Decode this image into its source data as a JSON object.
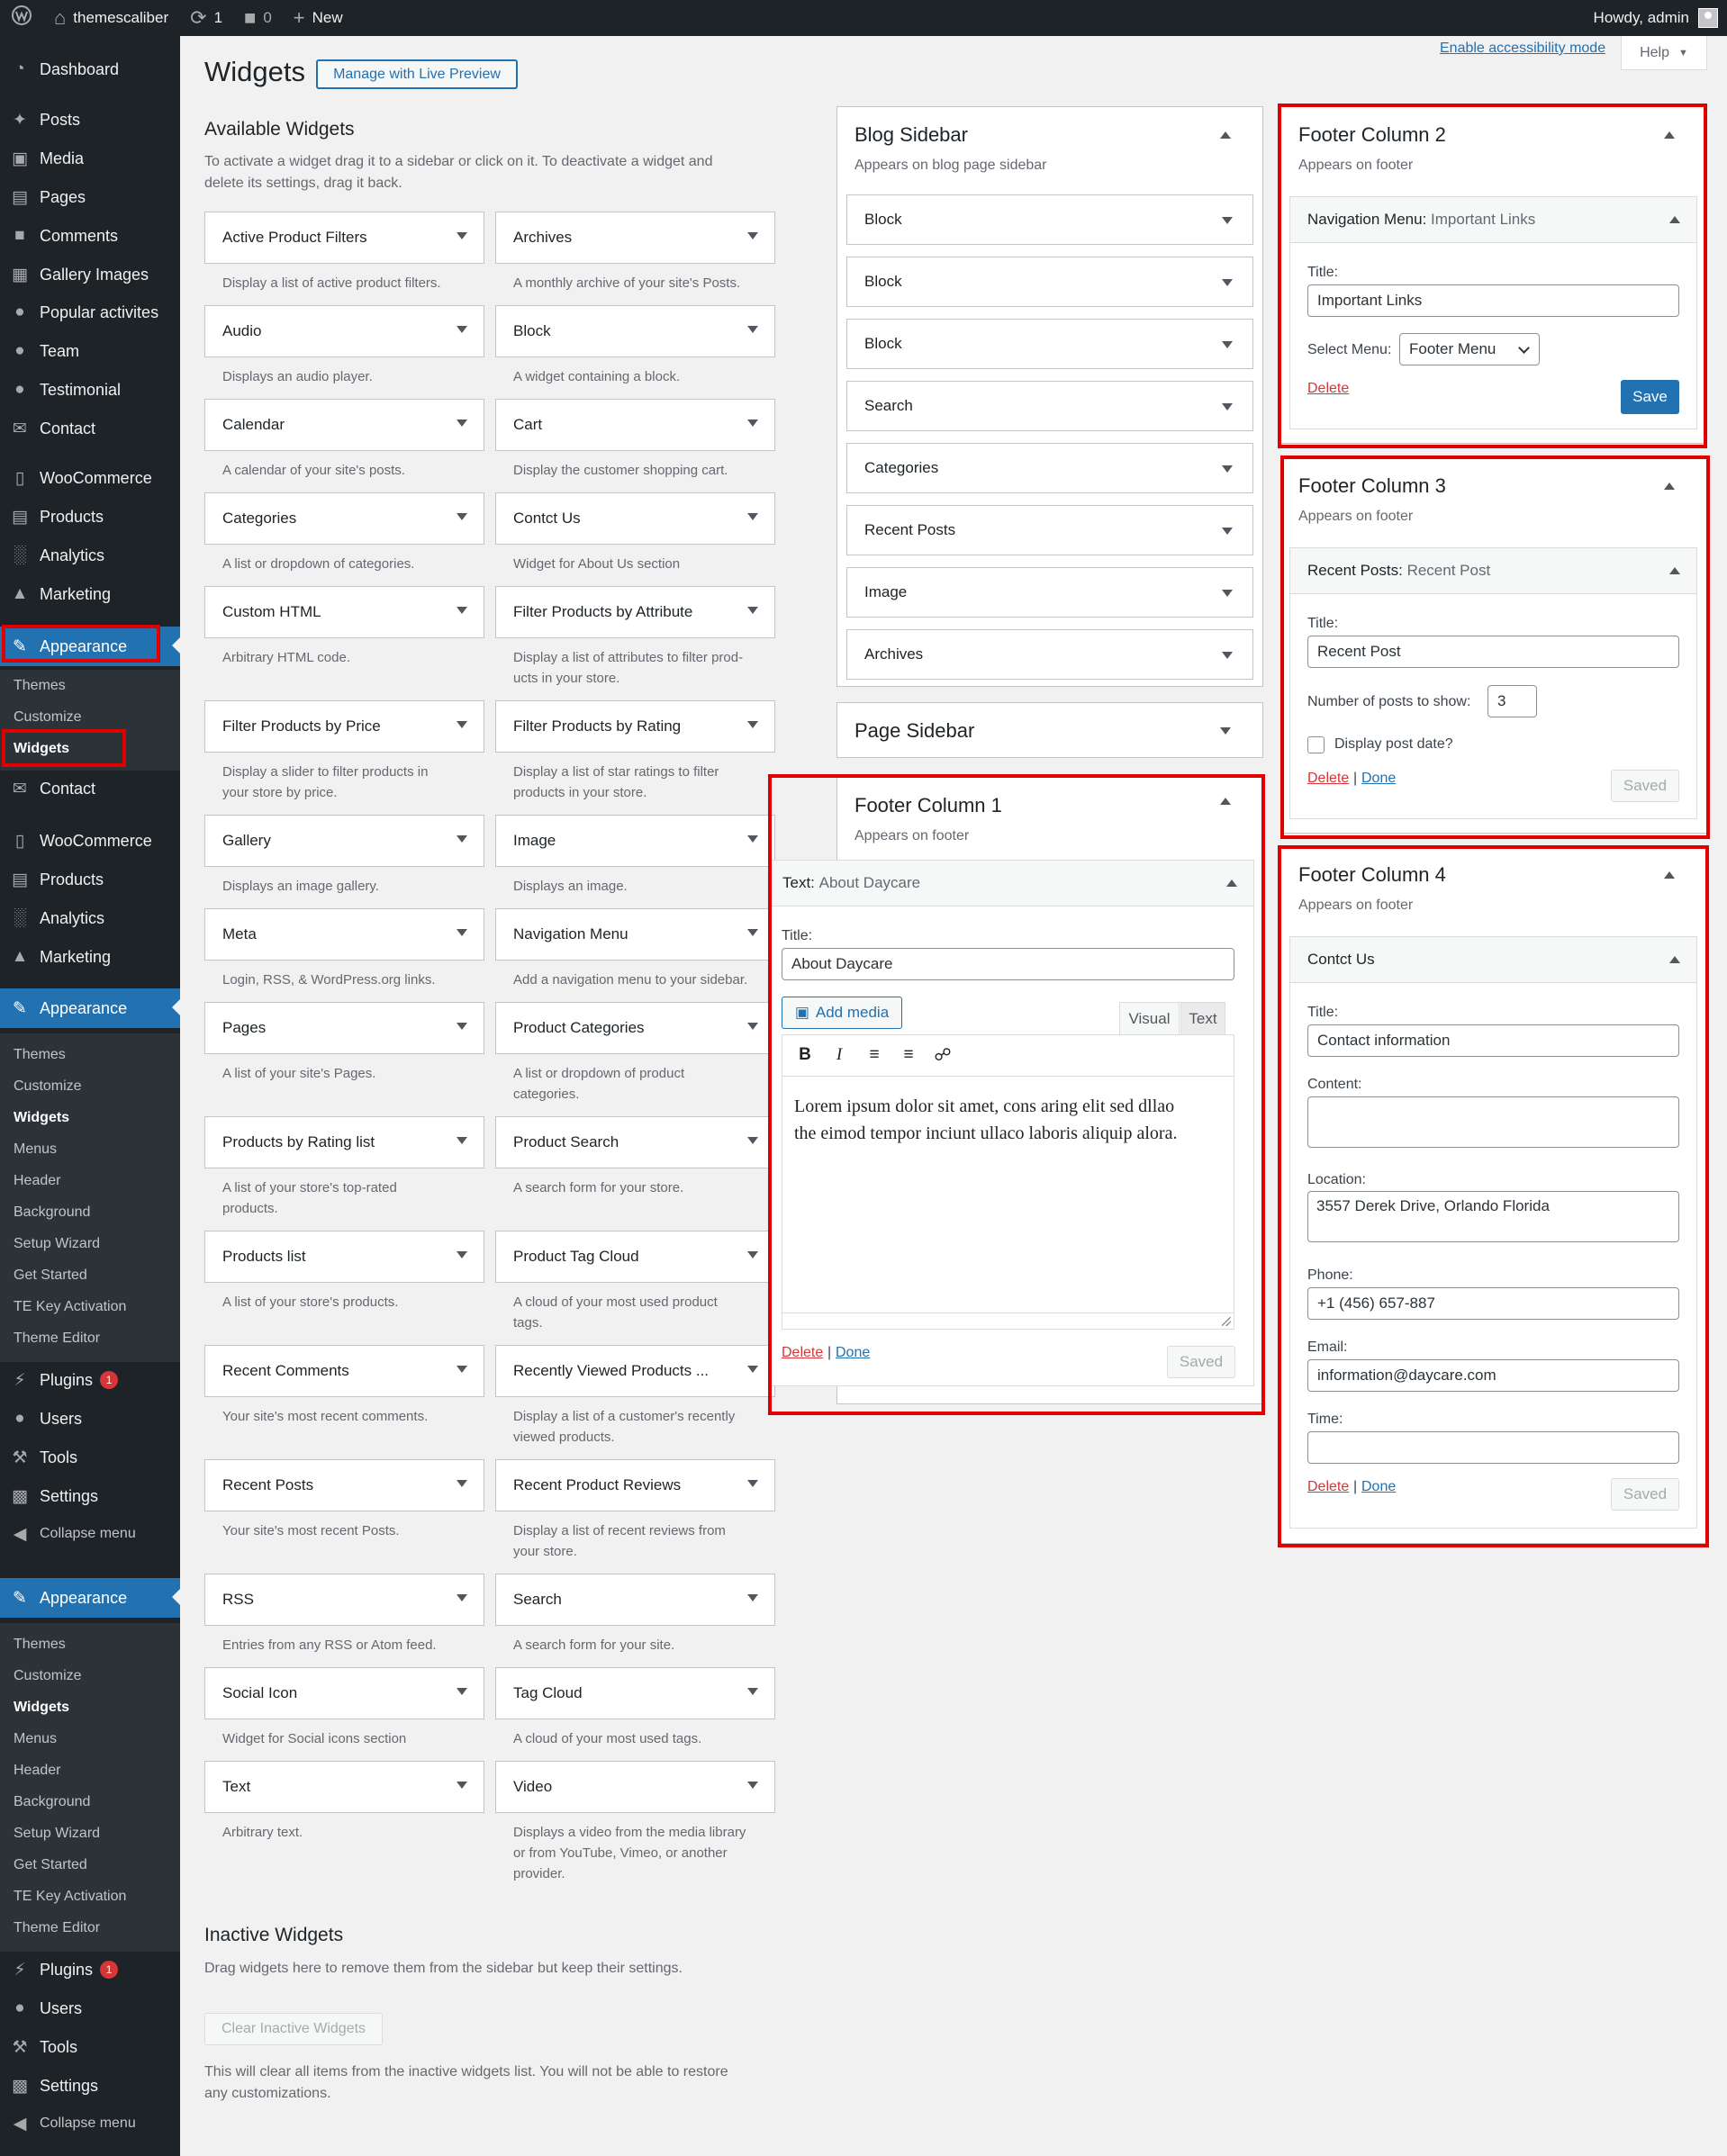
{
  "adminbar": {
    "site": "themescaliber",
    "updates": "1",
    "comments": "0",
    "new": "New",
    "howdy": "Howdy, admin"
  },
  "menu": {
    "dashboard": "Dashboard",
    "posts": "Posts",
    "media": "Media",
    "pages": "Pages",
    "comments": "Comments",
    "gallery": "Gallery Images",
    "popular": "Popular activites",
    "team": "Team",
    "testimonial": "Testimonial",
    "contact": "Contact",
    "woocommerce": "WooCommerce",
    "products": "Products",
    "analytics": "Analytics",
    "marketing": "Marketing",
    "appearance": "Appearance",
    "plugins": "Plugins",
    "plugins_count": "1",
    "users": "Users",
    "tools": "Tools",
    "settings": "Settings",
    "collapse": "Collapse menu"
  },
  "submenu_full": {
    "themes": "Themes",
    "customize": "Customize",
    "widgets": "Widgets",
    "menus": "Menus",
    "header": "Header",
    "background": "Background",
    "setup_wizard": "Setup Wizard",
    "get_started": "Get Started",
    "te_key": "TE Key Activation",
    "theme_editor": "Theme Editor"
  },
  "page": {
    "title": "Widgets",
    "live_preview": "Manage with Live Preview",
    "accessibility": "Enable accessibility mode",
    "help": "Help"
  },
  "available": {
    "title": "Available Widgets",
    "desc_line1": "To activate a widget drag it to a sidebar or click on it. To deactivate a widget and",
    "desc_line2": "delete its settings, drag it back.",
    "widgets": [
      {
        "name": "Active Product Filters",
        "d1": "Display a list of active product filters.",
        "d2": ""
      },
      {
        "name": "Archives",
        "d1": "A monthly archive of your site's Posts.",
        "d2": ""
      },
      {
        "name": "Audio",
        "d1": "Displays an audio player.",
        "d2": ""
      },
      {
        "name": "Block",
        "d1": "A widget containing a block.",
        "d2": ""
      },
      {
        "name": "Calendar",
        "d1": "A calendar of your site's posts.",
        "d2": ""
      },
      {
        "name": "Cart",
        "d1": "Display the customer shopping cart.",
        "d2": ""
      },
      {
        "name": "Categories",
        "d1": "A list or dropdown of categories.",
        "d2": ""
      },
      {
        "name": "Contct Us",
        "d1": "Widget for About Us section",
        "d2": ""
      },
      {
        "name": "Custom HTML",
        "d1": "Arbitrary HTML code.",
        "d2": ""
      },
      {
        "name": "Filter Products by Attribute",
        "d1": "Display a list of attributes to filter prod-",
        "d2": "ucts in your store."
      },
      {
        "name": "Filter Products by Price",
        "d1": "Display a slider to filter products in",
        "d2": "your store by price."
      },
      {
        "name": "Filter Products by Rating",
        "d1": "Display a list of star ratings to filter",
        "d2": "products in your store."
      },
      {
        "name": "Gallery",
        "d1": "Displays an image gallery.",
        "d2": ""
      },
      {
        "name": "Image",
        "d1": "Displays an image.",
        "d2": ""
      },
      {
        "name": "Meta",
        "d1": "Login, RSS, & WordPress.org links.",
        "d2": ""
      },
      {
        "name": "Navigation Menu",
        "d1": "Add a navigation menu to your sidebar.",
        "d2": ""
      },
      {
        "name": "Pages",
        "d1": "A list of your site's Pages.",
        "d2": ""
      },
      {
        "name": "Product Categories",
        "d1": "A list or dropdown of product",
        "d2": "categories."
      },
      {
        "name": "Products by Rating list",
        "d1": "A list of your store's top-rated",
        "d2": "products."
      },
      {
        "name": "Product Search",
        "d1": "A search form for your store.",
        "d2": ""
      },
      {
        "name": "Products list",
        "d1": "A list of your store's products.",
        "d2": ""
      },
      {
        "name": "Product Tag Cloud",
        "d1": "A cloud of your most used product",
        "d2": "tags."
      },
      {
        "name": "Recent Comments",
        "d1": "Your site's most recent comments.",
        "d2": ""
      },
      {
        "name": "Recently Viewed Products ...",
        "d1": "Display a list of a customer's recently",
        "d2": "viewed products."
      },
      {
        "name": "Recent Posts",
        "d1": "Your site's most recent Posts.",
        "d2": ""
      },
      {
        "name": "Recent Product Reviews",
        "d1": "Display a list of recent reviews from",
        "d2": "your store."
      },
      {
        "name": "RSS",
        "d1": "Entries from any RSS or Atom feed.",
        "d2": ""
      },
      {
        "name": "Search",
        "d1": "A search form for your site.",
        "d2": ""
      },
      {
        "name": "Social Icon",
        "d1": "Widget for Social icons section",
        "d2": ""
      },
      {
        "name": "Tag Cloud",
        "d1": "A cloud of your most used tags.",
        "d2": ""
      },
      {
        "name": "Text",
        "d1": "Arbitrary text.",
        "d2": ""
      },
      {
        "name": "Video",
        "d1": "Displays a video from the media library",
        "d2": "or from YouTube, Vimeo, or another",
        "d3": "provider."
      }
    ]
  },
  "inactive": {
    "title": "Inactive Widgets",
    "desc": "Drag widgets here to remove them from the sidebar but keep their settings.",
    "clear_btn": "Clear Inactive Widgets",
    "note_line1": "This will clear all items from the inactive widgets list. You will not be able to restore",
    "note_line2": "any customizations."
  },
  "blog_sidebar": {
    "title": "Blog Sidebar",
    "desc": "Appears on blog page sidebar",
    "widgets": [
      "Block",
      "Block",
      "Block",
      "Search",
      "Categories",
      "Recent Posts",
      "Image",
      "Archives"
    ]
  },
  "page_sidebar": {
    "title": "Page Sidebar"
  },
  "footer1": {
    "title": "Footer Column 1",
    "desc": "Appears on footer",
    "widget_type": "Text:",
    "widget_name": "About Daycare",
    "title_label": "Title:",
    "title_value": "About Daycare",
    "add_media": "Add media",
    "tab_visual": "Visual",
    "tab_text": "Text",
    "content_line1": "Lorem ipsum dolor sit amet, cons aring elit sed dllao",
    "content_line2": "the eimod tempor inciunt ullaco laboris aliquip alora.",
    "delete": "Delete",
    "sep": "|",
    "done": "Done",
    "saved": "Saved"
  },
  "footer2": {
    "title": "Footer Column 2",
    "desc": "Appears on footer",
    "widget_type": "Navigation Menu:",
    "widget_name": "Important Links",
    "title_label": "Title:",
    "title_value": "Important Links",
    "menu_label": "Select Menu:",
    "menu_value": "Footer Menu",
    "delete": "Delete",
    "save": "Save"
  },
  "footer3": {
    "title": "Footer Column 3",
    "desc": "Appears on footer",
    "widget_type": "Recent Posts:",
    "widget_name": "Recent Post",
    "title_label": "Title:",
    "title_value": "Recent Post",
    "num_label": "Number of posts to show:",
    "num_value": "3",
    "date_label": "Display post date?",
    "delete": "Delete",
    "sep": "|",
    "done": "Done",
    "saved": "Saved"
  },
  "footer4": {
    "title": "Footer Column 4",
    "desc": "Appears on footer",
    "widget_name": "Contct Us",
    "title_label": "Title:",
    "title_value": "Contact information",
    "content_label": "Content:",
    "content_value": "",
    "location_label": "Location:",
    "location_value": "3557 Derek Drive, Orlando Florida",
    "phone_label": "Phone:",
    "phone_value": "+1 (456) 657-887",
    "email_label": "Email:",
    "email_value": "information@daycare.com",
    "time_label": "Time:",
    "time_value": "",
    "delete": "Delete",
    "sep": "|",
    "done": "Done",
    "saved": "Saved"
  }
}
